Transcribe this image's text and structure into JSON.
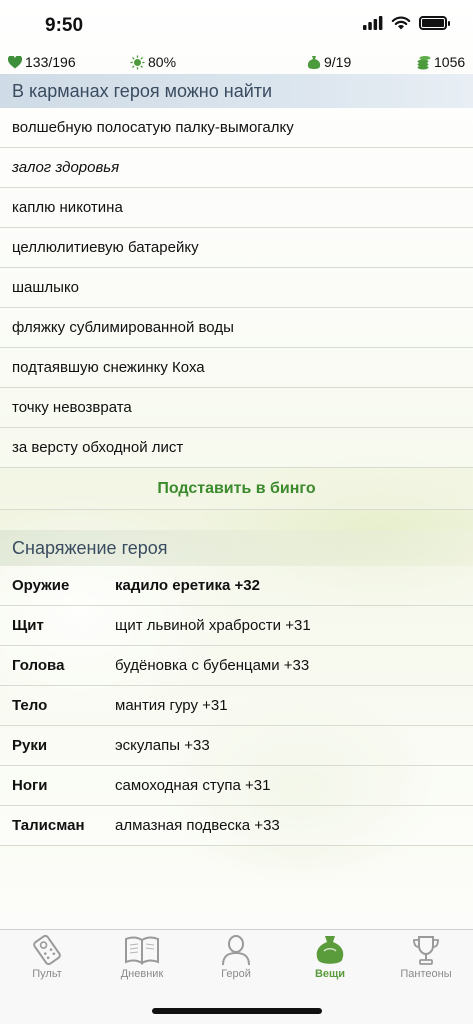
{
  "status_bar": {
    "time": "9:50"
  },
  "stats": {
    "health": "133/196",
    "godpower": "80%",
    "inventory": "9/19",
    "gold": "1056"
  },
  "pockets": {
    "title": "В карманах героя можно найти",
    "items": [
      "волшебную полосатую палку-вымогалку",
      "залог здоровья",
      "каплю никотина",
      "целлюлитиевую батарейку",
      "шашлыко",
      "фляжку сублимированной воды",
      "подтаявшую снежинку Коха",
      "точку невозврата",
      "за версту обходной лист"
    ],
    "bingo_button": "Подставить в бинго"
  },
  "equipment": {
    "title": "Снаряжение героя",
    "items": [
      {
        "slot": "Оружие",
        "value": "кадило еретика +32"
      },
      {
        "slot": "Щит",
        "value": "щит львиной храбрости +31"
      },
      {
        "slot": "Голова",
        "value": "будёновка с бубенцами +33"
      },
      {
        "slot": "Тело",
        "value": "мантия гуру +31"
      },
      {
        "slot": "Руки",
        "value": "эскулапы +33"
      },
      {
        "slot": "Ноги",
        "value": "самоходная ступа +31"
      },
      {
        "slot": "Талисман",
        "value": "алмазная подвеска +33"
      }
    ]
  },
  "tabs": [
    {
      "label": "Пульт",
      "icon": "remote-icon"
    },
    {
      "label": "Дневник",
      "icon": "book-icon"
    },
    {
      "label": "Герой",
      "icon": "hero-icon"
    },
    {
      "label": "Вещи",
      "icon": "bag-icon",
      "active": true
    },
    {
      "label": "Пантеоны",
      "icon": "trophy-icon"
    }
  ],
  "colors": {
    "accent_green": "#5a9b3b",
    "bingo_green": "#3c8a2e",
    "header_blue": "#3a4c60",
    "inactive_tab": "#8a8a8a"
  }
}
